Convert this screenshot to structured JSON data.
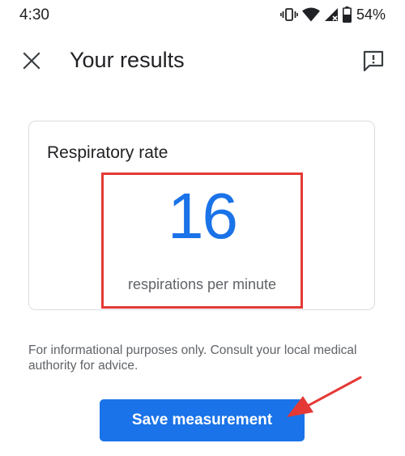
{
  "status_bar": {
    "time": "4:30",
    "battery_percent": "54%",
    "icons": [
      "vibrate-icon",
      "wifi-icon",
      "cell-signal-icon",
      "battery-icon"
    ]
  },
  "app_bar": {
    "title": "Your results",
    "close_icon": "close-icon",
    "feedback_icon": "feedback-icon"
  },
  "result": {
    "title": "Respiratory rate",
    "value": "16",
    "unit": "respirations per minute"
  },
  "disclaimer": "For informational purposes only. Consult your local medical authority for advice.",
  "actions": {
    "save_label": "Save measurement"
  },
  "colors": {
    "accent": "#1a73e8",
    "highlight": "#e53935",
    "text_primary": "#202124",
    "text_secondary": "#5f6368",
    "card_border": "#dadce0"
  }
}
